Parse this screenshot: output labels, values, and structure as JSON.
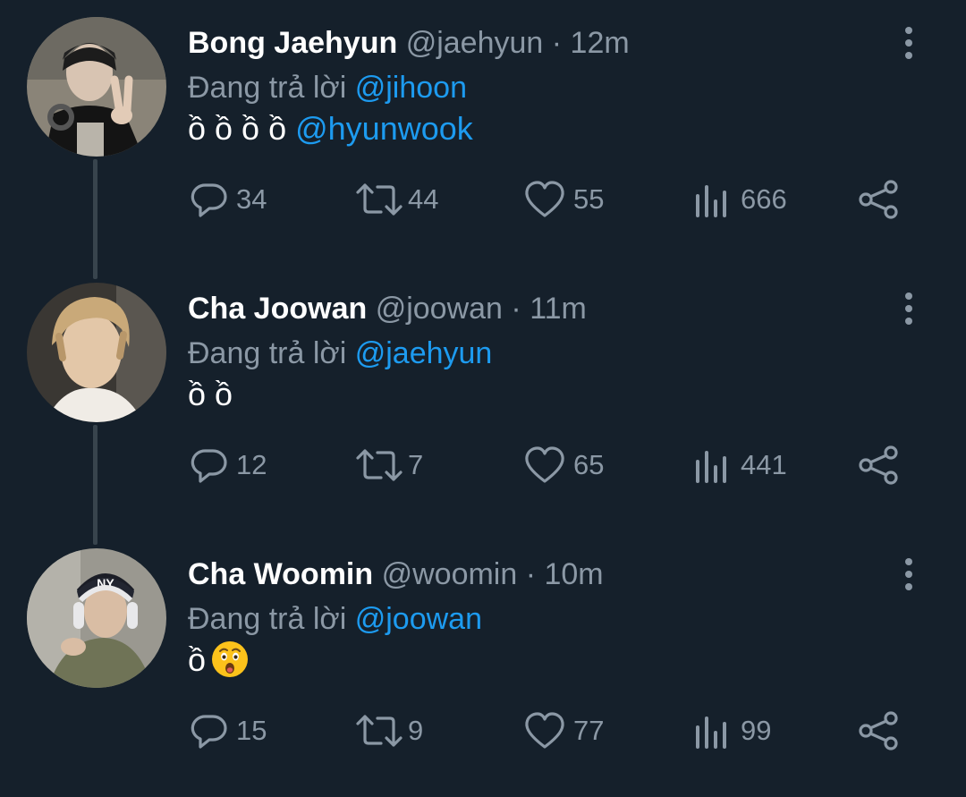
{
  "tweets": [
    {
      "name": "Bong Jaehyun",
      "handle": "@jaehyun",
      "time": "· 12m",
      "reply_prefix": "Đang trả lời",
      "reply_to": "@jihoon",
      "text": "ồ ồ ồ ồ",
      "text_mention": "@hyunwook",
      "stats": {
        "replies": "34",
        "retweets": "44",
        "likes": "55",
        "views": "666"
      }
    },
    {
      "name": "Cha Joowan",
      "handle": "@joowan",
      "time": "· 11m",
      "reply_prefix": "Đang trả lời",
      "reply_to": "@jaehyun",
      "text": "ồ ồ",
      "stats": {
        "replies": "12",
        "retweets": "7",
        "likes": "65",
        "views": "441"
      }
    },
    {
      "name": "Cha Woomin",
      "handle": "@woomin",
      "time": "· 10m",
      "reply_prefix": "Đang trả lời",
      "reply_to": "@joowan",
      "text": "ồ",
      "text_emoji": "astonished-face",
      "stats": {
        "replies": "15",
        "retweets": "9",
        "likes": "77",
        "views": "99"
      }
    }
  ],
  "colors": {
    "background": "#15202b",
    "secondary_text": "#8b98a5",
    "mention": "#1d9bf0",
    "thread_line": "#38444d"
  },
  "icons": [
    "reply-icon",
    "retweet-icon",
    "like-icon",
    "views-icon",
    "share-icon",
    "more-options-icon"
  ]
}
